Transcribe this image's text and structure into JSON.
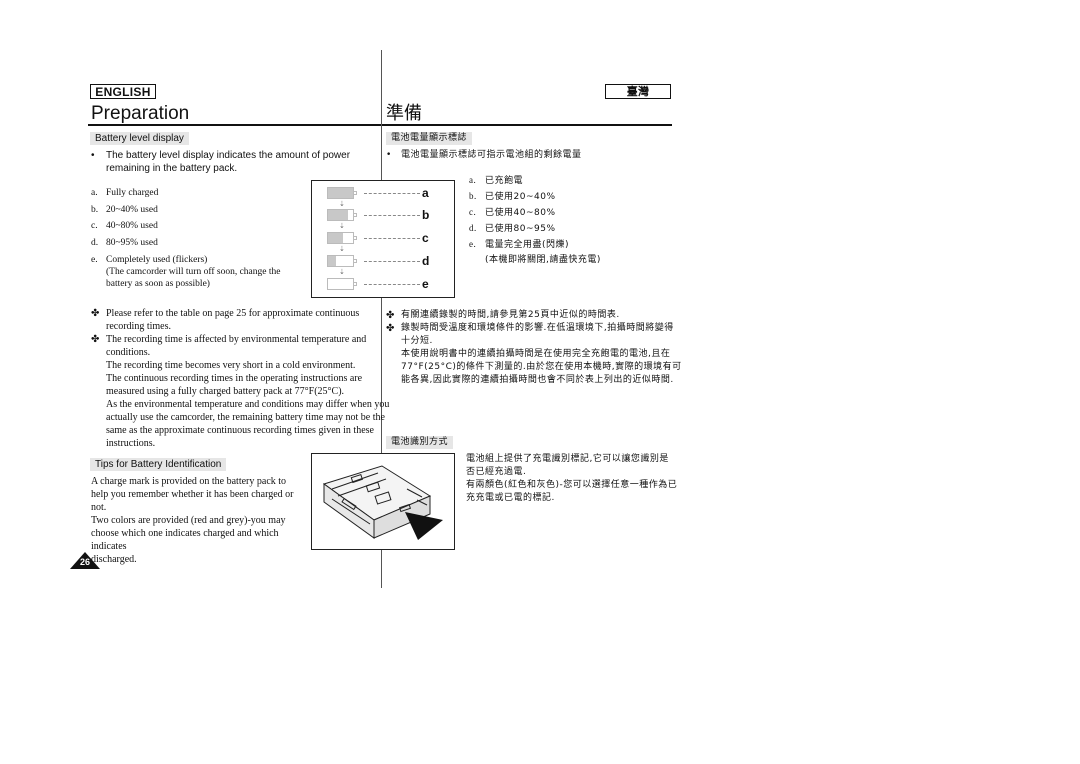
{
  "header": {
    "lang_en": "ENGLISH",
    "lang_zh": "臺灣",
    "title_en": "Preparation",
    "title_zh": "準備"
  },
  "battery_display": {
    "heading_en": "Battery level display",
    "heading_zh": "電池電量顯示標誌",
    "intro_en": "The battery level display indicates the amount of power remaining in the battery pack.",
    "intro_zh": "電池電量顯示標誌可指示電池組的剩餘電量",
    "bullet": "•",
    "levels_en": [
      {
        "letter": "a.",
        "text": "Fully charged"
      },
      {
        "letter": "b.",
        "text": "20~40% used"
      },
      {
        "letter": "c.",
        "text": "40~80% used"
      },
      {
        "letter": "d.",
        "text": "80~95% used"
      },
      {
        "letter": "e.",
        "text": "Completely used (flickers)",
        "note_1": "(The camcorder will turn off soon, change the",
        "note_2": "battery as soon as possible)"
      }
    ],
    "levels_zh": [
      {
        "letter": "a.",
        "text": "已充飽電"
      },
      {
        "letter": "b.",
        "text": "已使用20~40%"
      },
      {
        "letter": "c.",
        "text": "已使用40~80%"
      },
      {
        "letter": "d.",
        "text": "已使用80~95%"
      },
      {
        "letter": "e.",
        "text": "電量完全用盡(閃爍)",
        "note": "(本機即將關閉,請盡快充電)"
      }
    ],
    "diagram": {
      "labels": [
        "a",
        "b",
        "c",
        "d",
        "e"
      ],
      "fill_fraction": [
        1.0,
        0.8,
        0.6,
        0.3,
        0.0
      ],
      "arrow": "⇣"
    }
  },
  "notes_en": {
    "marker": "✤",
    "note1": [
      "Please refer to the table on page 25 for approximate continuous",
      "recording times."
    ],
    "note2": [
      "The recording time is affected by environmental temperature and",
      "conditions.",
      "The recording time becomes very short in a cold environment.",
      "The continuous recording times in the operating instructions are",
      "measured using a fully charged battery pack at 77°F(25°C).",
      "As the environmental temperature and conditions may differ when you",
      "actually use the camcorder, the remaining battery time may not be the",
      "same as the approximate continuous recording times given in these",
      "instructions."
    ]
  },
  "notes_zh": {
    "marker": "✤",
    "note1": [
      "有關連續錄製的時間,請參見第25頁中近似的時間表."
    ],
    "note2": [
      "錄製時間受溫度和環境條件的影響.在低溫環境下,拍攝時間將變得",
      "十分短.",
      "本使用說明書中的連續拍攝時間是在使用完全充飽電的電池,且在",
      "77°F(25°C)的條件下測量的.由於您在使用本機時,實際的環境有可",
      "能各異,因此實際的連續拍攝時間也會不同於表上列出的近似時間."
    ]
  },
  "battery_id": {
    "heading_en": "Tips for Battery Identification",
    "heading_zh": "電池識別方式",
    "text_en": [
      "A charge mark is provided on the battery pack to",
      "help you remember whether it has been charged or not.",
      "Two colors are provided (red and grey)-you may",
      "choose which one indicates charged and which indicates",
      "discharged."
    ],
    "text_zh": [
      "電池組上提供了充電識別標記,它可以讓您識別是",
      "否已經充過電.",
      "有兩顏色(紅色和灰色)-您可以選擇任意一種作為已",
      "充充電或已電的標記."
    ]
  },
  "footer": {
    "page_number": "26"
  }
}
